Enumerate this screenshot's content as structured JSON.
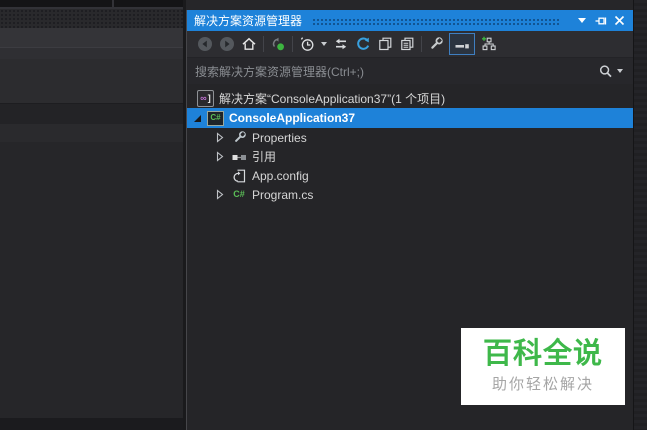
{
  "colors": {
    "titlebar_blue": "#1e82d9",
    "selection_blue": "#1e82d9",
    "watermark_green": "#3eb84a",
    "csharp_green": "#5bbf57",
    "solution_purple": "#c174d4",
    "panel_background": "#252528"
  },
  "panel": {
    "title": "解决方案资源管理器",
    "window_controls": [
      "window-position-caret",
      "pin",
      "close"
    ],
    "toolbar_icons": [
      "back",
      "forward",
      "home",
      "changes-filter",
      "pending-filter-clock",
      "filter-dropdown",
      "sync-with-active-document",
      "refresh",
      "preview-document",
      "copy-document",
      "properties-wrench",
      "show-all-files",
      "new-solution-folder"
    ],
    "search": {
      "placeholder": "搜索解决方案资源管理器(Ctrl+;)"
    },
    "tree": {
      "solution": {
        "label": "解决方案“ConsoleApplication37”(1 个项目)",
        "icon": "solution"
      },
      "items": [
        {
          "label": "ConsoleApplication37",
          "icon": "csharp-project",
          "selected": true,
          "expanded": true
        },
        {
          "label": "Properties",
          "icon": "wrench",
          "collapsed": true
        },
        {
          "label": "引用",
          "icon": "references",
          "collapsed": true
        },
        {
          "label": "App.config",
          "icon": "config-file"
        },
        {
          "label": "Program.cs",
          "icon": "csharp-file",
          "collapsed": true
        }
      ]
    }
  },
  "watermark": {
    "title": "百科全说",
    "subtitle": "助你轻松解决"
  }
}
